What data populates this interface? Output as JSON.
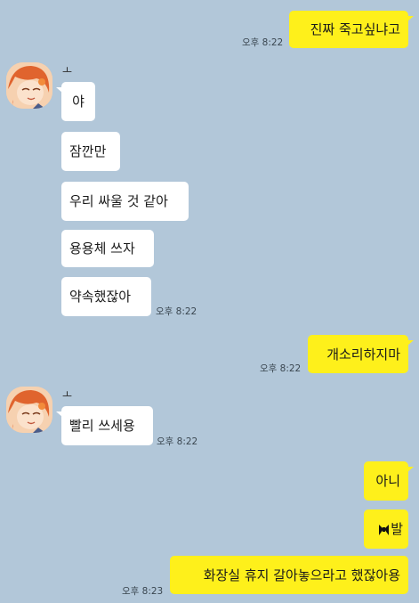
{
  "chat": {
    "messages": [
      {
        "side": "out",
        "text": "진짜 죽고싶냐고"
      },
      {
        "side": "in",
        "sender": "ㅗ",
        "texts": [
          "야",
          "잠깐만",
          "우리 싸울 것 같아",
          "용용체 쓰자",
          "약속했잖아"
        ],
        "time": "오후 8:22"
      },
      {
        "side": "out",
        "text": "개소리하지마",
        "time": "오후 8:22"
      },
      {
        "side": "in",
        "sender": "ㅗ",
        "texts": [
          "빨리 쓰세용"
        ],
        "time": "오후 8:22"
      },
      {
        "side": "out",
        "texts": [
          "아니",
          "발",
          "화장실 휴지 갈아놓으라고 했잖아용"
        ],
        "time": "오후 8:23"
      }
    ],
    "top_time": "오후 8:22"
  },
  "colors": {
    "background": "#b2c7d9",
    "outgoing_bubble": "#fef01b",
    "incoming_bubble": "#ffffff"
  },
  "icons": {
    "avatar": "anime-character-avatar",
    "censor": "black-bow-censor-icon"
  }
}
